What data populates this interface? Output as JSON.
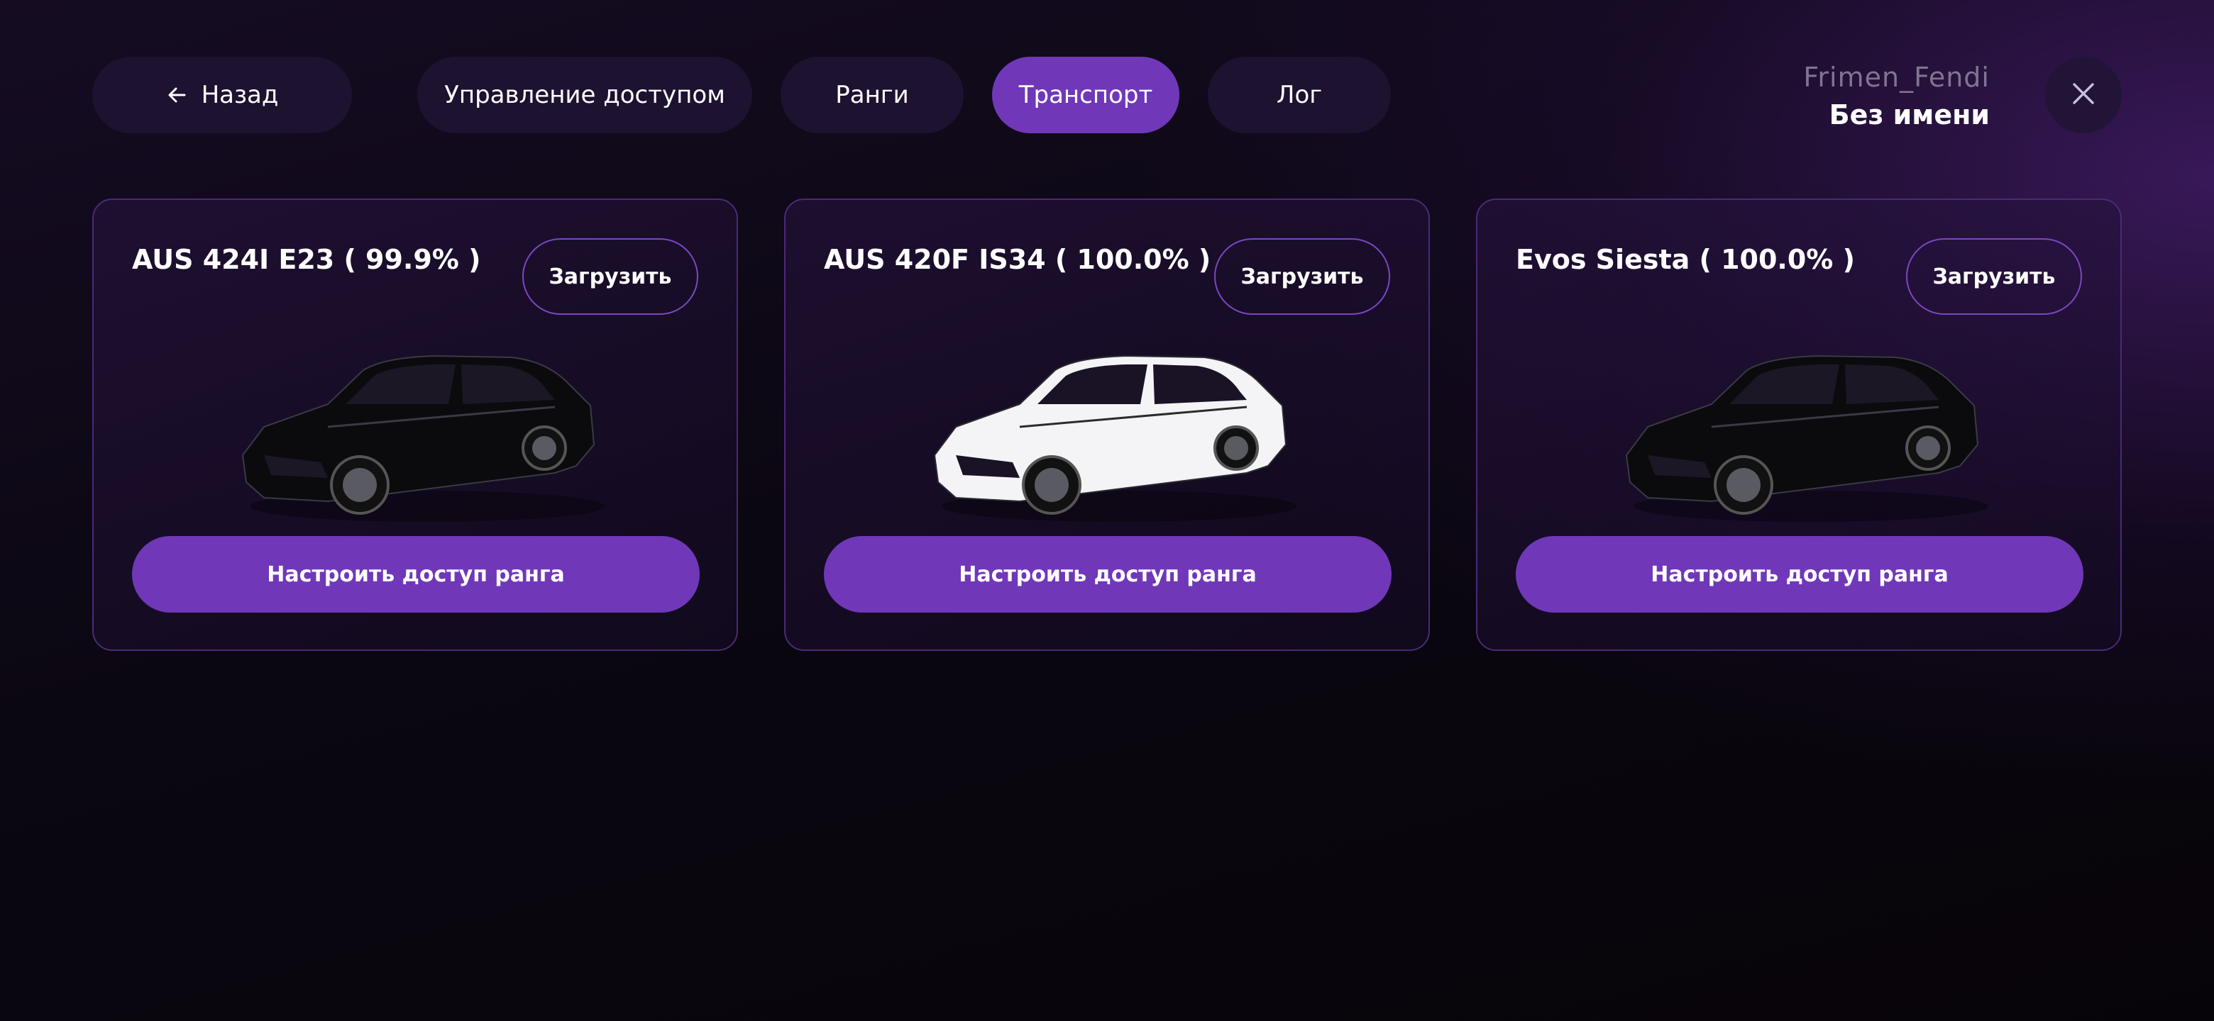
{
  "nav": {
    "back_label": "Назад",
    "tabs": [
      {
        "label": "Управление доступом",
        "active": false
      },
      {
        "label": "Ранги",
        "active": false
      },
      {
        "label": "Транспорт",
        "active": true
      },
      {
        "label": "Лог",
        "active": false
      }
    ]
  },
  "user": {
    "username": "Frimen_Fendi",
    "group_name": "Без имени"
  },
  "vehicles": [
    {
      "name": "AUS 424I E23 ( 99.9% )",
      "load_label": "Загрузить",
      "configure_label": "Настроить доступ ранга",
      "car_color": "#0b0b0e"
    },
    {
      "name": "AUS 420F IS34 ( 100.0% )",
      "load_label": "Загрузить",
      "configure_label": "Настроить доступ ранга",
      "car_color": "#f4f4f6"
    },
    {
      "name": "Evos Siesta ( 100.0% )",
      "load_label": "Загрузить",
      "configure_label": "Настроить доступ ранга",
      "car_color": "#0b0b0e"
    }
  ],
  "colors": {
    "accent": "#7038b8",
    "pill_bg": "#1d1230",
    "card_border": "#4a2a78"
  },
  "icons": {
    "back": "arrow-left-icon",
    "close": "close-icon",
    "vehicle": "car-icon"
  }
}
